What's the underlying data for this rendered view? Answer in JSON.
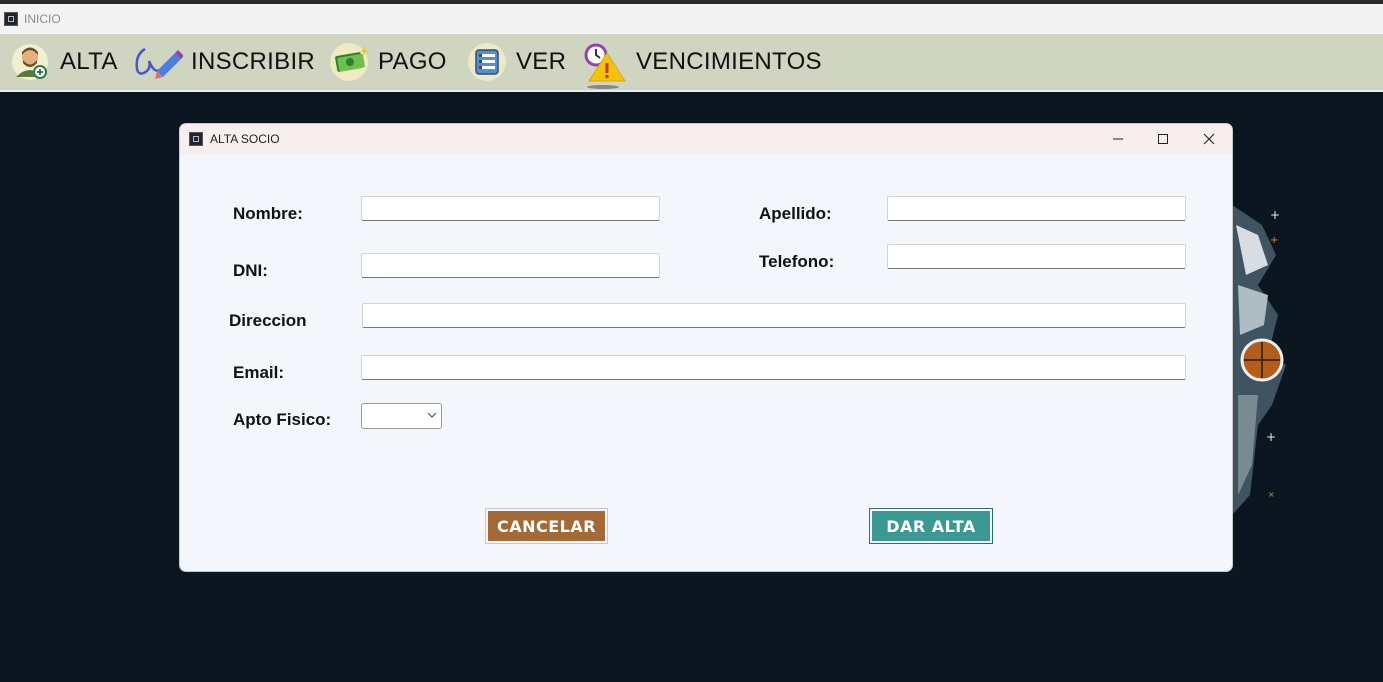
{
  "main_window": {
    "title": "INICIO"
  },
  "menu": {
    "items": [
      {
        "label": "ALTA",
        "icon": "user-add-icon"
      },
      {
        "label": "INSCRIBIR",
        "icon": "pen-signature-icon"
      },
      {
        "label": "PAGO",
        "icon": "money-icon"
      },
      {
        "label": "VER",
        "icon": "list-icon"
      },
      {
        "label": "VENCIMIENTOS",
        "icon": "warning-clock-icon"
      }
    ]
  },
  "dialog": {
    "title": "ALTA SOCIO",
    "form": {
      "nombre": {
        "label": "Nombre:",
        "value": ""
      },
      "apellido": {
        "label": "Apellido:",
        "value": ""
      },
      "dni": {
        "label": "DNI:",
        "value": ""
      },
      "telefono": {
        "label": "Telefono:",
        "value": ""
      },
      "direccion": {
        "label": "Direccion",
        "value": ""
      },
      "email": {
        "label": "Email:",
        "value": ""
      },
      "apto_fisico": {
        "label": "Apto Fisico:",
        "value": ""
      }
    },
    "buttons": {
      "cancel": "CANCELAR",
      "submit": "DAR ALTA"
    }
  },
  "colors": {
    "menubar": "#cfd5c1",
    "background": "#0c1620",
    "cancel_button": "#a36a38",
    "submit_button": "#3c9892"
  }
}
